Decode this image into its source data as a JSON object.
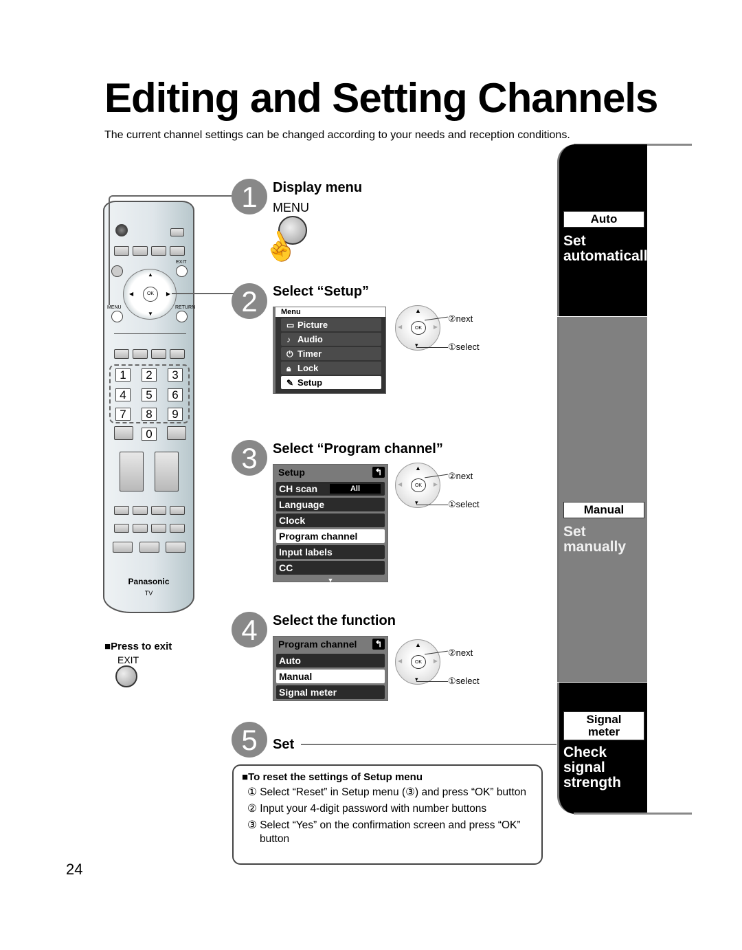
{
  "page": {
    "title": "Editing and Setting Channels",
    "subtitle": "The current channel settings can be changed according to your needs and reception conditions.",
    "page_number": "24"
  },
  "remote": {
    "brand": "Panasonic",
    "brand_sub": "TV",
    "labels": {
      "exit": "EXIT",
      "menu": "MENU",
      "return": "RETURN",
      "ok": "OK"
    },
    "number_keys": [
      "1",
      "2",
      "3",
      "4",
      "5",
      "6",
      "7",
      "8",
      "9",
      "0"
    ]
  },
  "exit_note": {
    "title": "Press to exit",
    "key_label": "EXIT"
  },
  "steps": [
    {
      "number": "1",
      "title": "Display menu",
      "key_label": "MENU"
    },
    {
      "number": "2",
      "title": "Select “Setup”"
    },
    {
      "number": "3",
      "title": "Select “Program channel”"
    },
    {
      "number": "4",
      "title": "Select the function"
    },
    {
      "number": "5",
      "title": "Set"
    }
  ],
  "menu_osd": {
    "header": "Menu",
    "items": [
      {
        "icon": "picture-icon",
        "label": "Picture",
        "selected": false
      },
      {
        "icon": "audio-icon",
        "label": "Audio",
        "selected": false
      },
      {
        "icon": "timer-icon",
        "label": "Timer",
        "selected": false
      },
      {
        "icon": "lock-icon",
        "label": "Lock",
        "selected": false
      },
      {
        "icon": "setup-icon",
        "label": "Setup",
        "selected": true
      }
    ]
  },
  "setup_osd": {
    "header": "Setup",
    "items": [
      {
        "label": "CH scan",
        "value": "All",
        "selected": false
      },
      {
        "label": "Language",
        "selected": false
      },
      {
        "label": "Clock",
        "selected": false
      },
      {
        "label": "Program channel",
        "selected": true
      },
      {
        "label": "Input labels",
        "selected": false
      },
      {
        "label": "CC",
        "selected": false
      }
    ]
  },
  "program_osd": {
    "header": "Program channel",
    "items": [
      {
        "label": "Auto",
        "selected": false
      },
      {
        "label": "Manual",
        "selected": true
      },
      {
        "label": "Signal meter",
        "selected": false
      }
    ]
  },
  "dial": {
    "ok": "OK",
    "next_label": "②next",
    "select_label": "①select"
  },
  "reset_box": {
    "title": "To reset the settings of Setup menu",
    "steps": [
      "① Select “Reset” in Setup menu (③) and press “OK” button",
      "② Input your 4-digit password with number buttons",
      "③ Select “Yes” on the confirmation screen and press “OK” button"
    ]
  },
  "side_tab": {
    "sections": [
      {
        "box": "Auto",
        "desc": "Set automatically"
      },
      {
        "box": "Manual",
        "desc": "Set manually"
      },
      {
        "box": "Signal meter",
        "desc": "Check signal strength"
      }
    ]
  },
  "colors": {
    "step_circle": "#888888",
    "osd_dark": "#333333",
    "side_dark": "#000000",
    "side_mid": "#808080"
  }
}
